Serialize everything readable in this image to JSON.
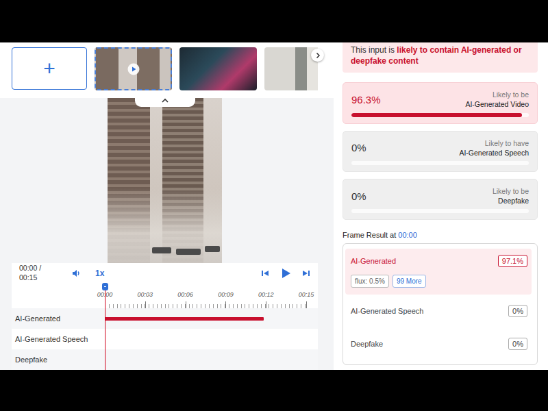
{
  "add_button": {
    "label": "+"
  },
  "thumbnails": [
    {
      "selected": true
    },
    {
      "selected": false
    },
    {
      "selected": false
    }
  ],
  "player": {
    "time": "00:00 / 00:15",
    "speed": "1x",
    "level": 0
  },
  "timeline": {
    "ticks": [
      "00:00",
      "00:03",
      "00:06",
      "00:09",
      "00:12",
      "00:15"
    ],
    "rows": [
      {
        "label": "AI-Generated",
        "level": 0.79
      },
      {
        "label": "AI-Generated Speech",
        "level": 0
      },
      {
        "label": "Deepfake",
        "level": 0
      }
    ]
  },
  "alert": {
    "prefix": "This input is ",
    "highlight": "likely to contain AI-generated or deepfake content"
  },
  "scores": [
    {
      "value": "96.3%",
      "caption_top": "Likely to be",
      "caption": "AI-Generated Video",
      "level": 0.963,
      "flagged": true
    },
    {
      "value": "0%",
      "caption_top": "Likely to have",
      "caption": "AI-Generated Speech",
      "level": 0,
      "flagged": false
    },
    {
      "value": "0%",
      "caption_top": "Likely to be",
      "caption": "Deepfake",
      "level": 0,
      "flagged": false
    }
  ],
  "frame_result": {
    "label": "Frame Result at ",
    "time": "00:00",
    "rows": [
      {
        "label": "AI-Generated",
        "value": "97.1%",
        "flagged": true,
        "tags": [
          {
            "text": "flux: 0.5%",
            "kind": "tag"
          },
          {
            "text": "99 More",
            "kind": "link"
          }
        ]
      },
      {
        "label": "AI-Generated Speech",
        "value": "0%",
        "flagged": false,
        "tags": []
      },
      {
        "label": "Deepfake",
        "value": "0%",
        "flagged": false,
        "tags": []
      }
    ]
  }
}
